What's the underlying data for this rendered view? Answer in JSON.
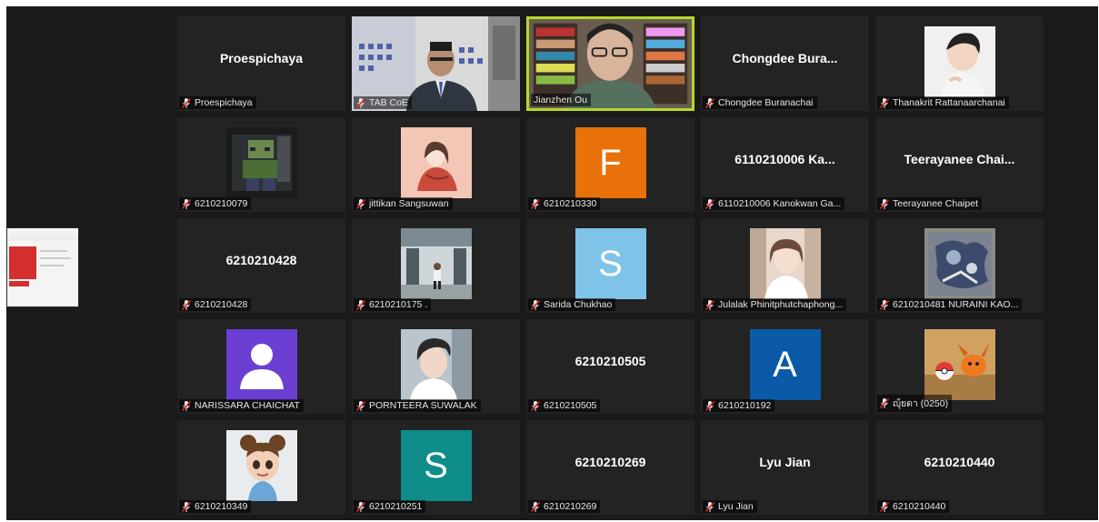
{
  "app": {
    "mic_muted_icon": "mic-muted-icon",
    "speaker_highlight": "#b5d82b"
  },
  "share_thumbnail": {
    "icon": "screen-share-thumbnail",
    "accent": "#d32f2f"
  },
  "participants": [
    {
      "label": "Proespichaya",
      "center_name": "Proespichaya",
      "avatar": "none",
      "muted": true
    },
    {
      "label": "TAB CoE",
      "avatar": "camera-video",
      "muted": true
    },
    {
      "label": "Jianzhen Ou",
      "avatar": "camera-video",
      "active_speaker": true,
      "muted": false
    },
    {
      "label": "Chongdee Buranachai",
      "center_name": "Chongdee  Bura...",
      "avatar": "none",
      "muted": true
    },
    {
      "label": "Thanakrit Rattanaarchanai",
      "avatar": "profile-photo",
      "muted": true
    },
    {
      "label": "6210210079",
      "avatar": "profile-photo",
      "muted": true
    },
    {
      "label": "jittikan Sangsuwan",
      "avatar": "profile-illustration",
      "muted": true
    },
    {
      "label": "6210210330",
      "avatar": "letter",
      "letter": "F",
      "avatar_color": "#e8710a",
      "muted": true
    },
    {
      "label": "6110210006 Kanokwan Ga...",
      "center_name": "6110210006 Ka...",
      "avatar": "none",
      "muted": true
    },
    {
      "label": "Teerayanee Chaipet",
      "center_name": "Teerayanee  Chai...",
      "avatar": "none",
      "muted": true
    },
    {
      "label": "6210210428",
      "center_name": "6210210428",
      "avatar": "none",
      "muted": true
    },
    {
      "label": "6210210175 .",
      "avatar": "profile-photo",
      "muted": true
    },
    {
      "label": "Sarida Chukhao",
      "avatar": "letter",
      "letter": "S",
      "avatar_color": "#7fc4e8",
      "muted": true
    },
    {
      "label": "Julalak Phinitphutchaphong...",
      "avatar": "profile-photo",
      "muted": true
    },
    {
      "label": "6210210481 NURAINI KAO...",
      "avatar": "profile-photo",
      "muted": true
    },
    {
      "label": "NARISSARA CHAICHAT",
      "avatar": "default-person-icon",
      "avatar_color": "#6b3fd4",
      "muted": true
    },
    {
      "label": "PORNTEERA SUWALAK",
      "avatar": "profile-photo",
      "muted": true
    },
    {
      "label": "6210210505",
      "center_name": "6210210505",
      "avatar": "none",
      "muted": true
    },
    {
      "label": "6210210192",
      "avatar": "letter",
      "letter": "A",
      "avatar_color": "#0b5aa8",
      "muted": true
    },
    {
      "label": "ญุ้ยดา (0250)",
      "avatar": "profile-photo",
      "muted": true
    },
    {
      "label": "6210210349",
      "avatar": "profile-illustration",
      "muted": true
    },
    {
      "label": "6210210251",
      "avatar": "letter",
      "letter": "S",
      "avatar_color": "#0e8d8a",
      "muted": true
    },
    {
      "label": "6210210269",
      "center_name": "6210210269",
      "avatar": "none",
      "muted": true
    },
    {
      "label": "Lyu Jian",
      "center_name": "Lyu Jian",
      "avatar": "none",
      "muted": true
    },
    {
      "label": "6210210440",
      "center_name": "6210210440",
      "avatar": "none",
      "muted": true
    }
  ]
}
